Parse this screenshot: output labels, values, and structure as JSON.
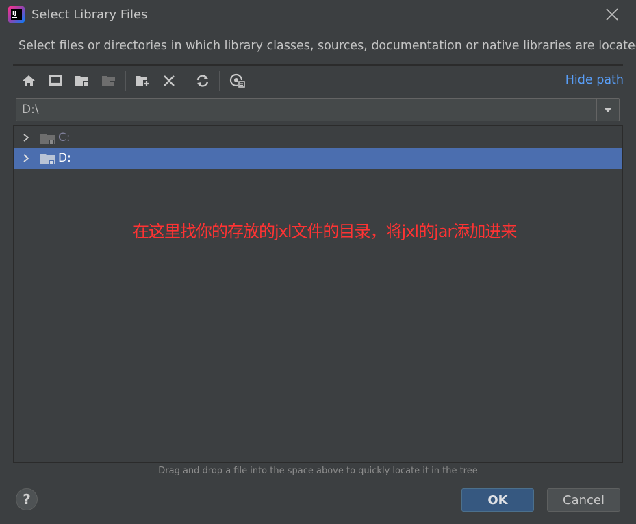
{
  "dialog": {
    "title": "Select Library Files",
    "description": "Select files or directories in which library classes, sources, documentation or native libraries are located"
  },
  "toolbar": {
    "icons": [
      "home-icon",
      "desktop-icon",
      "project-folder-icon",
      "module-folder-icon",
      "new-folder-icon",
      "delete-icon",
      "refresh-icon",
      "show-hidden-icon"
    ],
    "hide_path_label": "Hide path"
  },
  "path": {
    "value": "D:\\"
  },
  "tree": {
    "items": [
      {
        "label": "C:",
        "selected": false
      },
      {
        "label": "D:",
        "selected": true
      }
    ]
  },
  "annotation": {
    "text": "在这里找你的存放的jxl文件的目录，将jxl的jar添加进来"
  },
  "hint": "Drag and drop a file into the space above to quickly locate it in the tree",
  "buttons": {
    "help": "?",
    "ok": "OK",
    "cancel": "Cancel"
  },
  "colors": {
    "background": "#3c3f41",
    "selection": "#4b6eaf",
    "link": "#589df6",
    "annotation": "#ff3333",
    "ok_button": "#365880"
  }
}
